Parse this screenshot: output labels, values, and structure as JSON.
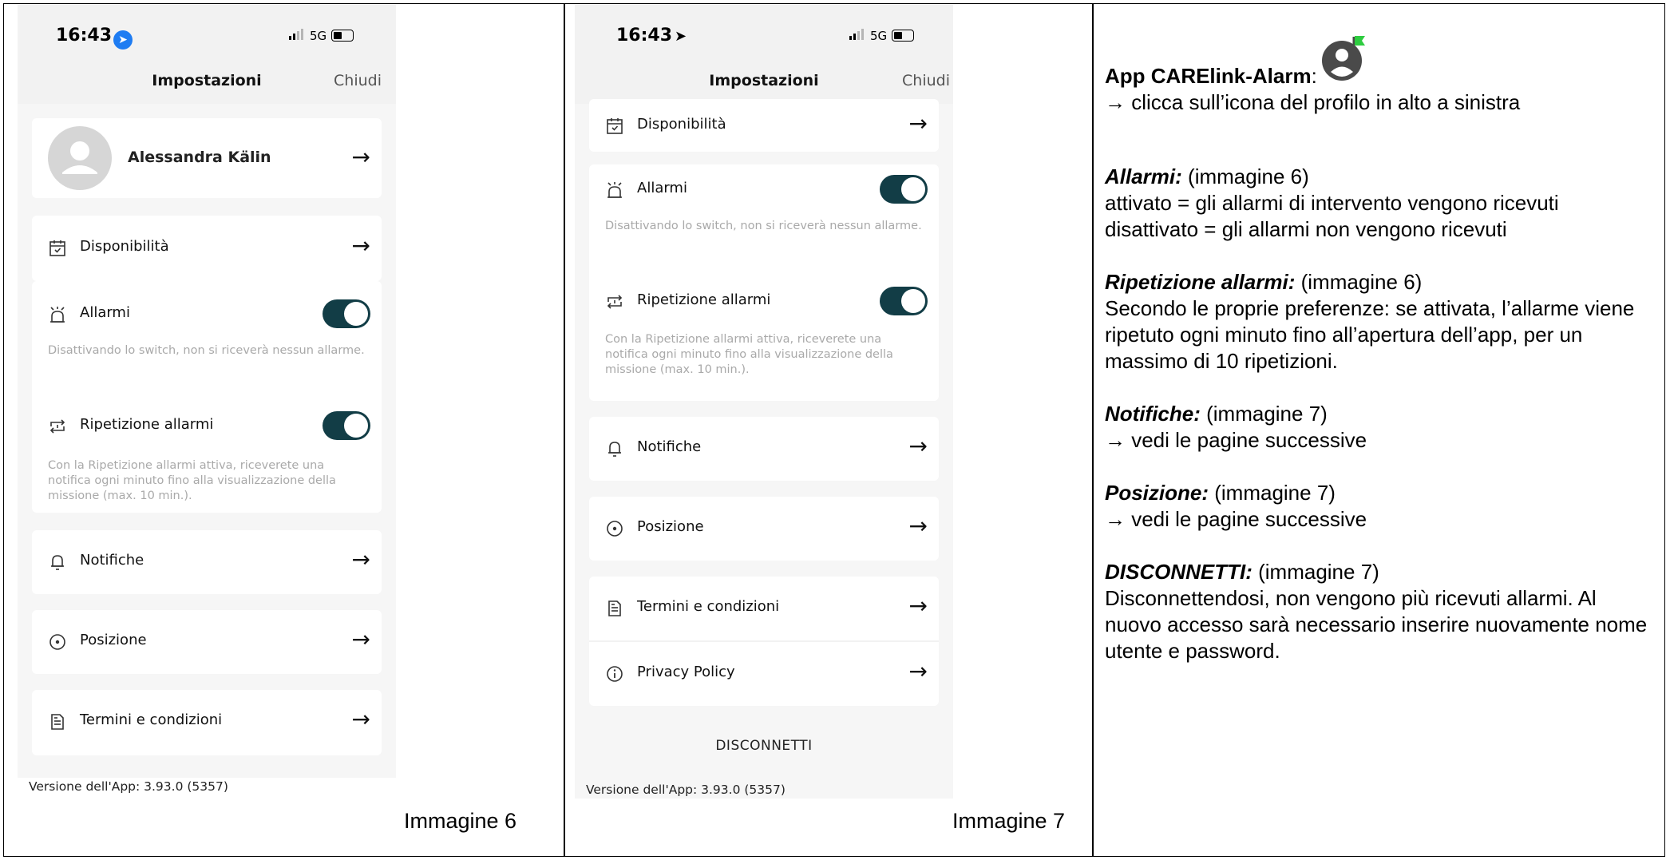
{
  "left_panel": {
    "status_time": "16:43",
    "network": "5G",
    "nav_title": "Impostazioni",
    "nav_close": "Chiudi",
    "profile_name": "Alessandra Kälin",
    "items": {
      "availability": "Disponibilità",
      "alarms": "Allarmi",
      "alarms_hint": "Disattivando lo switch, non si riceverà nessun allarme.",
      "repeat": "Ripetizione allarmi",
      "repeat_hint": "Con la Ripetizione allarmi attiva, riceverete una notifica ogni minuto fino alla visualizzazione della missione (max. 10 min.).",
      "notifications": "Notifiche",
      "position": "Posizione",
      "terms": "Termini e condizioni"
    },
    "version": "Versione dell'App: 3.93.0 (5357)",
    "caption": "Immagine 6"
  },
  "middle_panel": {
    "status_time": "16:43",
    "network": "5G",
    "nav_title": "Impostazioni",
    "nav_close": "Chiudi",
    "items": {
      "availability": "Disponibilità",
      "alarms": "Allarmi",
      "alarms_hint": "Disattivando lo switch, non si riceverà nessun allarme.",
      "repeat": "Ripetizione allarmi",
      "repeat_hint": "Con la Ripetizione allarmi attiva, riceverete una notifica ogni minuto fino alla visualizzazione della missione (max. 10 min.).",
      "notifications": "Notifiche",
      "position": "Posizione",
      "terms": "Termini e condizioni",
      "privacy": "Privacy Policy"
    },
    "disconnect": "DISCONNETTI",
    "version": "Versione dell'App: 3.93.0 (5357)",
    "caption": "Immagine 7"
  },
  "right_panel": {
    "app_name": "App CARElink-Alarm",
    "app_colon": ":",
    "app_instruction": "→ clicca sull’icona del profilo in alto a sinistra",
    "alarms_title": "Allarmi:",
    "alarms_ref": " (immagine 6)",
    "alarms_on": "attivato = gli allarmi di intervento vengono ricevuti",
    "alarms_off": "disattivato = gli allarmi non vengono ricevuti",
    "repeat_title": "Ripetizione allarmi:",
    "repeat_ref": " (immagine 6)",
    "repeat_text": "Secondo le proprie preferenze: se attivata, l’allarme viene ripetuto ogni minuto fino all’apertura dell’app, per un massimo di 10 ripetizioni.",
    "notif_title": "Notifiche:",
    "notif_ref": " (immagine 7)",
    "notif_text": "→ vedi le pagine successive",
    "pos_title": "Posizione:",
    "pos_ref": " (immagine 7)",
    "pos_text": "→ vedi le pagine successive",
    "disc_title": "DISCONNETTI:",
    "disc_ref": " (immagine 7)",
    "disc_text": "Disconnettendosi, non vengono più ricevuti allarmi. Al nuovo accesso sarà necessario inserire nuovamente nome utente e password."
  },
  "colors": {
    "toggle_on": "#123d46",
    "hint_text": "#a9a9a9",
    "location_badge": "#1e7cf2",
    "icon_flag": "#2ecc40",
    "icon_circle": "#4a4a4a"
  }
}
